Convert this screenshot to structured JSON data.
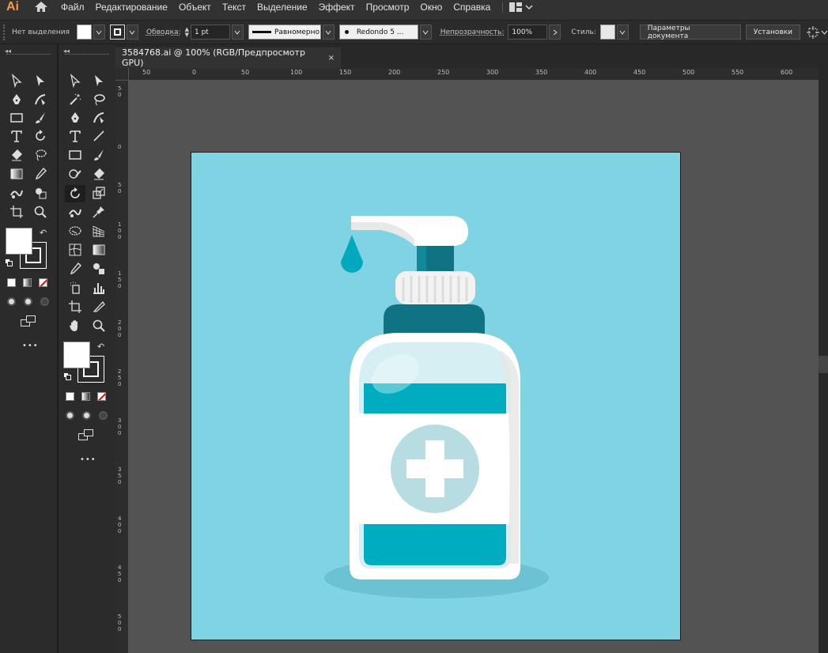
{
  "app": {
    "logo": "Ai"
  },
  "menu": [
    "Файл",
    "Редактирование",
    "Объект",
    "Текст",
    "Выделение",
    "Эффект",
    "Просмотр",
    "Окно",
    "Справка"
  ],
  "control": {
    "selection": "Нет выделения",
    "stroke_label": "Обводка:",
    "stroke_weight": "1 pt",
    "stroke_profile": "Равномерно",
    "brush": "Redondo 5 ...",
    "opacity_label": "Непрозрачность:",
    "opacity": "100%",
    "style_label": "Стиль:",
    "doc_settings": "Параметры документа",
    "preferences": "Установки"
  },
  "tab": {
    "title": "3584768.ai @ 100% (RGB/Предпросмотр GPU)",
    "close": "×"
  },
  "ruler": {
    "h": [
      "50",
      "0",
      "50",
      "100",
      "150",
      "200",
      "250",
      "300",
      "350",
      "400",
      "450",
      "500",
      "550",
      "600"
    ],
    "v": [
      "5 0",
      "0",
      "5 0",
      "1 0 0",
      "1 5 0",
      "2 0 0",
      "2 5 0",
      "3 0 0",
      "3 5 0",
      "4 0 0",
      "4 5 0",
      "5 0 0"
    ]
  },
  "more": "•••",
  "colors": {
    "artboard": "#7fd3e3",
    "bottle_teal": "#00acc0",
    "cap_dark": "#0f7384",
    "accent": "#f29b4a"
  }
}
